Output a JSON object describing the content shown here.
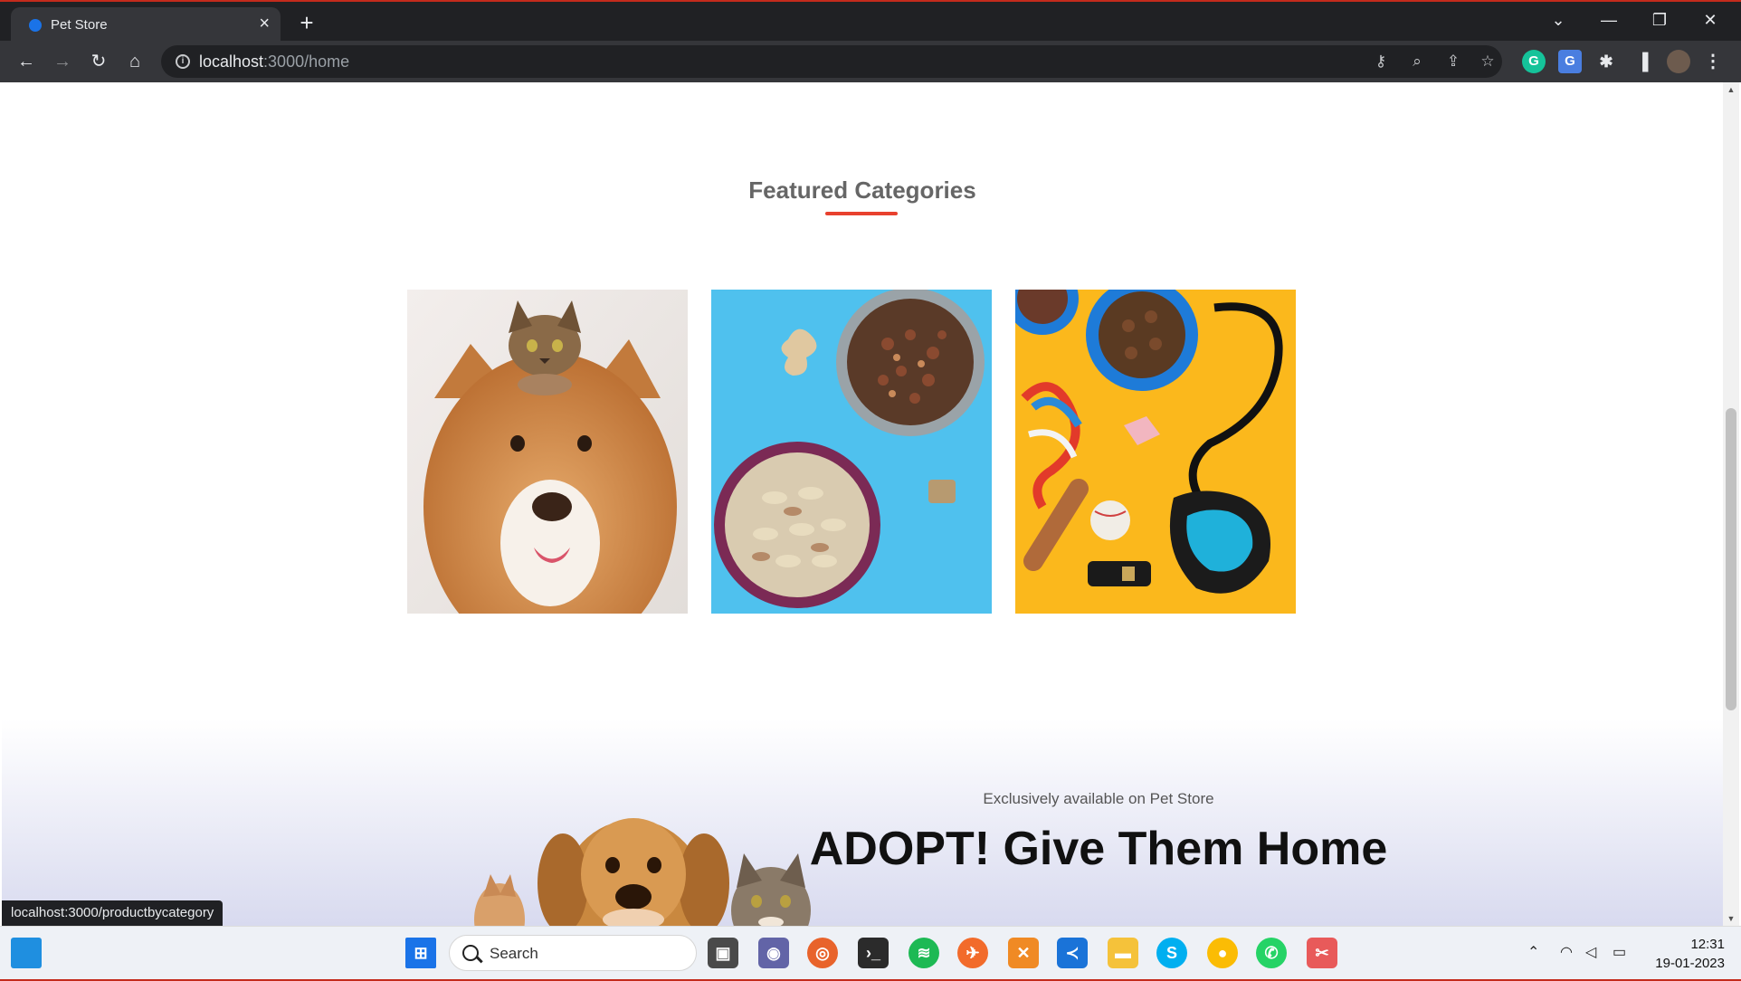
{
  "browser": {
    "tab_title": "Pet Store",
    "new_tab": "+",
    "url_host": "localhost",
    "url_path": ":3000/home",
    "window_controls": {
      "minimize": "—",
      "restore": "❐",
      "close": "✕",
      "tab_search": "⌄"
    }
  },
  "page": {
    "section_title": "Featured Categories",
    "categories": [
      {
        "name": "pets-category-card",
        "image": "dog with kitten on head"
      },
      {
        "name": "food-category-card",
        "image": "bowls of pet food"
      },
      {
        "name": "accessories-category-card",
        "image": "pet toys, leash and collar"
      }
    ],
    "adopt": {
      "tagline": "Exclusively available on Pet Store",
      "heading": "ADOPT! Give Them Home"
    },
    "status_url": "localhost:3000/productbycategory"
  },
  "taskbar": {
    "search_label": "Search",
    "time": "12:31",
    "date": "19-01-2023"
  },
  "colors": {
    "accent": "#e8412e",
    "chrome_dark": "#202124",
    "chrome_toolbar": "#35363a"
  }
}
